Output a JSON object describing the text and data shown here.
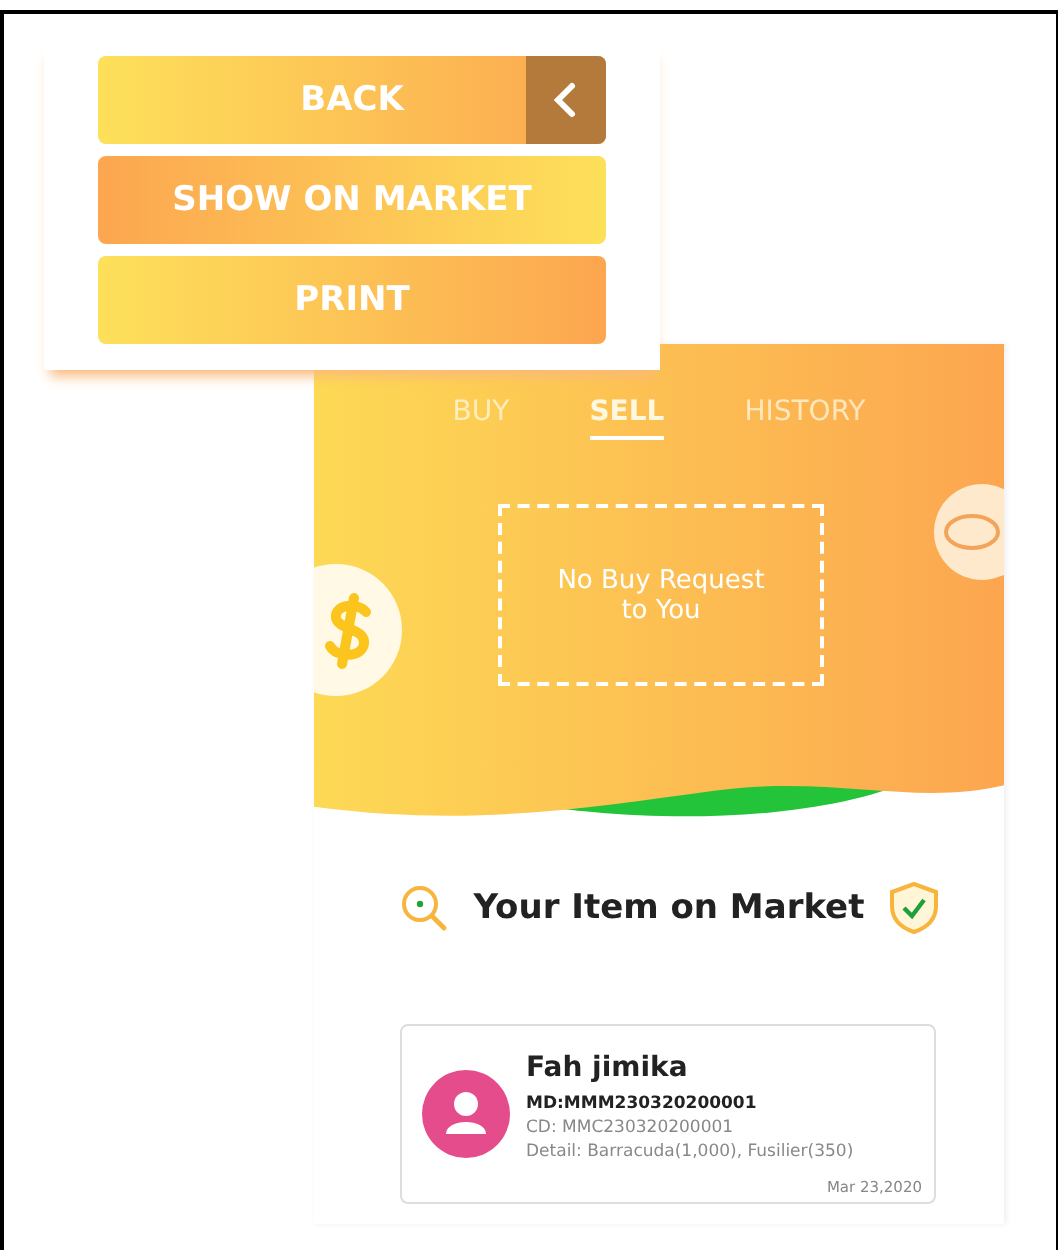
{
  "menu": {
    "buttons": [
      {
        "label": "BACK",
        "kind": "back"
      },
      {
        "label": "SHOW ON MARKET",
        "kind": "plain"
      },
      {
        "label": "PRINT",
        "kind": "plain"
      }
    ]
  },
  "tabs": [
    {
      "label": "BUY",
      "selected": false
    },
    {
      "label": "SELL",
      "selected": true
    },
    {
      "label": "HISTORY",
      "selected": false
    }
  ],
  "empty_message": "No Buy Request to You",
  "section_title": "Your Item on Market",
  "items": [
    {
      "name": "Fah jimika",
      "md": "MD:MMM230320200001",
      "cd": "CD: MMC230320200001",
      "detail": "Detail: Barracuda(1,000), Fusilier(350)",
      "date": "Mar 23,2020"
    }
  ]
}
